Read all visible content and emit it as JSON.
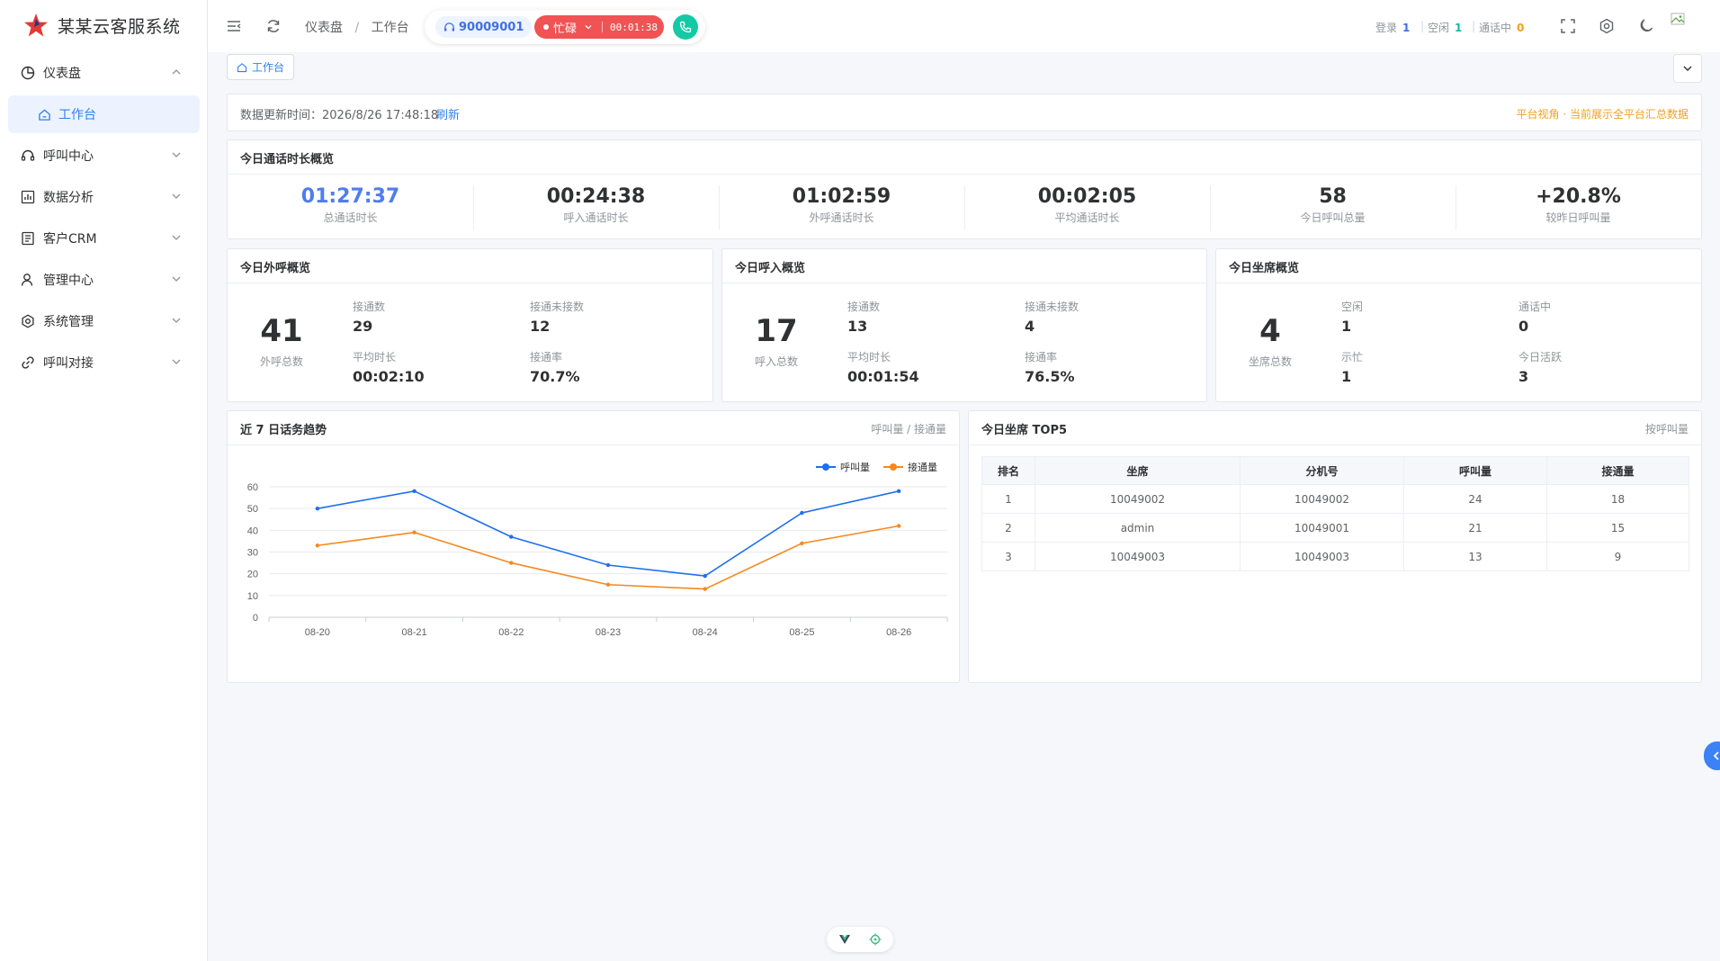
{
  "app": {
    "title": "某某云客服系统"
  },
  "sidebar": {
    "items": [
      {
        "label": "仪表盘",
        "icon": "pie-chart-icon",
        "expanded": true
      },
      {
        "label": "呼叫中心",
        "icon": "headset-icon"
      },
      {
        "label": "数据分析",
        "icon": "bar-chart-icon"
      },
      {
        "label": "客户CRM",
        "icon": "contacts-icon"
      },
      {
        "label": "管理中心",
        "icon": "user-icon"
      },
      {
        "label": "系统管理",
        "icon": "gear-icon"
      },
      {
        "label": "呼叫对接",
        "icon": "link-icon"
      }
    ],
    "sub_items": [
      {
        "label": "工作台",
        "icon": "home-icon",
        "active": true
      }
    ]
  },
  "header": {
    "breadcrumb": [
      "仪表盘",
      "工作台"
    ],
    "breadcrumb_sep": "/",
    "extension": "90009001",
    "status_label": "忙碌",
    "status_timer": "00:01:38",
    "stats": [
      {
        "label": "登录",
        "value": "1",
        "color": "#3f6ee8"
      },
      {
        "label": "空闲",
        "value": "1",
        "color": "#14b8a6"
      },
      {
        "label": "通话中",
        "value": "0",
        "color": "#f0a020"
      }
    ]
  },
  "tabs": [
    {
      "label": "工作台"
    }
  ],
  "info_bar": {
    "update_text": "数据更新时间：2026/8/26 17:48:18",
    "refresh_label": "刷新",
    "note": "平台视角 · 当前展示全平台汇总数据"
  },
  "duration_overview": {
    "title": "今日通话时长概览",
    "items": [
      {
        "value": "01:27:37",
        "label": "总通话时长"
      },
      {
        "value": "00:24:38",
        "label": "呼入通话时长"
      },
      {
        "value": "01:02:59",
        "label": "外呼通话时长"
      },
      {
        "value": "00:02:05",
        "label": "平均通话时长"
      },
      {
        "value": "58",
        "label": "今日呼叫总量"
      },
      {
        "value": "+20.8%",
        "label": "较昨日呼叫量"
      }
    ]
  },
  "outbound": {
    "title": "今日外呼概览",
    "total": "41",
    "total_label": "外呼总数",
    "connected_label": "接通数",
    "connected": "29",
    "missed_label": "接通未接数",
    "missed": "12",
    "avg_label": "平均时长",
    "avg": "00:02:10",
    "rate_label": "接通率",
    "rate": "70.7%"
  },
  "inbound": {
    "title": "今日呼入概览",
    "total": "17",
    "total_label": "呼入总数",
    "connected_label": "接通数",
    "connected": "13",
    "missed_label": "接通未接数",
    "missed": "4",
    "avg_label": "平均时长",
    "avg": "00:01:54",
    "rate_label": "接通率",
    "rate": "76.5%"
  },
  "agents": {
    "title": "今日坐席概览",
    "total": "4",
    "total_label": "坐席总数",
    "idle_label": "空闲",
    "idle": "1",
    "talking_label": "通话中",
    "talking": "0",
    "busy_label": "示忙",
    "busy": "1",
    "active_label": "今日活跃",
    "active": "3"
  },
  "trend": {
    "title": "近 7 日话务趋势",
    "note": "呼叫量 / 接通量"
  },
  "chart_data": {
    "type": "line",
    "title": "近 7 日话务趋势",
    "categories": [
      "08-20",
      "08-21",
      "08-22",
      "08-23",
      "08-24",
      "08-25",
      "08-26"
    ],
    "series": [
      {
        "name": "呼叫量",
        "color": "#1e6ff0",
        "values": [
          50,
          58,
          37,
          24,
          19,
          48,
          58
        ]
      },
      {
        "name": "接通量",
        "color": "#f5891f",
        "values": [
          33,
          39,
          25,
          15,
          13,
          34,
          42
        ]
      }
    ],
    "y_ticks": [
      "0",
      "10",
      "20",
      "30",
      "40",
      "50",
      "60"
    ],
    "ylim": [
      0,
      60
    ],
    "grid": true,
    "legend": "top-right"
  },
  "top5": {
    "title": "今日坐席 TOP5",
    "note": "按呼叫量",
    "columns": [
      "排名",
      "坐席",
      "分机号",
      "呼叫量",
      "接通量"
    ],
    "rows": [
      [
        "1",
        "10049002",
        "10049002",
        "24",
        "18"
      ],
      [
        "2",
        "admin",
        "10049001",
        "21",
        "15"
      ],
      [
        "3",
        "10049003",
        "10049003",
        "13",
        "9"
      ]
    ]
  }
}
